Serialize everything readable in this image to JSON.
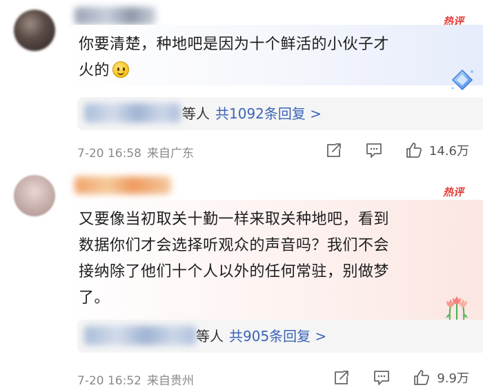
{
  "comments": [
    {
      "hot_badge": "热评",
      "text_line1": "你要清楚，种地吧是因为十个鲜活的小伙子才",
      "text_line2": "火的",
      "reply_etc": "等人",
      "reply_count": "共1092条回复 >",
      "date": "7-20 16:58",
      "location": "来自广东",
      "likes": "14.6万"
    },
    {
      "hot_badge": "热评",
      "text_line1": "又要像当初取关十勤一样来取关种地吧，看到",
      "text_line2": "数据你们才会选择听观众的声音吗？我们不会",
      "text_line3": "接纳除了他们十个人以外的任何常驻，别做梦",
      "text_line4": "了。",
      "reply_etc": "等人",
      "reply_count": "共905条回复 >",
      "date": "7-20 16:52",
      "location": "来自贵州",
      "likes": "9.9万"
    }
  ],
  "colors": {
    "hot_badge": "#e53935",
    "reply_link": "#3a63b7",
    "meta_text": "#8a8a8a"
  },
  "icons": [
    "emoji-smile-icon",
    "diamond-sticker-icon",
    "tulip-sticker-icon",
    "repost-icon",
    "comment-icon",
    "like-icon"
  ]
}
